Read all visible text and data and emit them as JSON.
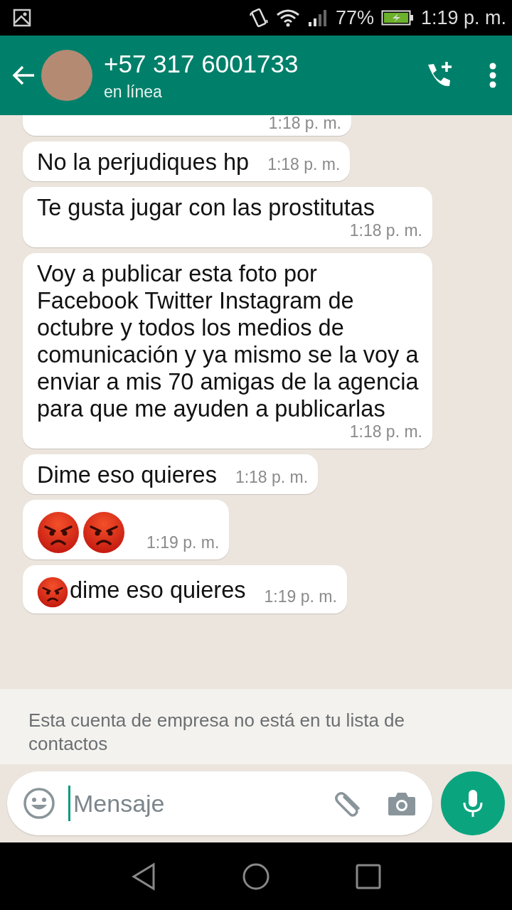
{
  "status_bar": {
    "battery": "77%",
    "time": "1:19 p. m."
  },
  "header": {
    "contact": "+57 317 6001733",
    "status": "en línea"
  },
  "messages": [
    {
      "kind": "cut",
      "time": "1:18 p. m."
    },
    {
      "kind": "full",
      "segments": [
        {
          "kind": "text",
          "text": "No la perjudiques hp"
        }
      ],
      "time": "1:18 p. m."
    },
    {
      "kind": "full",
      "segments": [
        {
          "kind": "text",
          "text": "Te gusta jugar con las prostitutas"
        }
      ],
      "time": "1:18 p. m."
    },
    {
      "kind": "full",
      "segments": [
        {
          "kind": "text",
          "text": "Voy a publicar esta foto por Facebook Twitter Instagram de octubre y todos los medios de comunicación y ya mismo se la voy a enviar a mis 70 amigas de la agencia para que me ayuden a publicarlas"
        }
      ],
      "time": "1:18 p. m."
    },
    {
      "kind": "full",
      "segments": [
        {
          "kind": "text",
          "text": "Dime eso quieres"
        }
      ],
      "time": "1:18 p. m."
    },
    {
      "kind": "full",
      "segments": [
        {
          "kind": "emoji"
        },
        {
          "kind": "emoji"
        }
      ],
      "time": "1:19 p. m."
    },
    {
      "kind": "full",
      "segments": [
        {
          "kind": "emoji"
        },
        {
          "kind": "text",
          "text": "dime eso quieres"
        }
      ],
      "time": "1:19 p. m."
    }
  ],
  "notice": "Esta cuenta de empresa no está en tu lista de contactos",
  "composer": {
    "placeholder": "Mensaje"
  }
}
